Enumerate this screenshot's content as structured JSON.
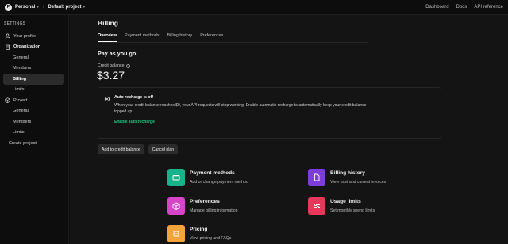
{
  "topbar": {
    "org_initial": "P",
    "org": "Personal",
    "slash": "/",
    "project": "Default project",
    "links": [
      "Dashboard",
      "Docs",
      "API reference"
    ]
  },
  "sidebar": {
    "heading": "SETTINGS",
    "your_profile": "Your profile",
    "organization": "Organization",
    "org_items": [
      "General",
      "Members",
      "Billing",
      "Limits"
    ],
    "project": "Project",
    "project_items": [
      "General",
      "Members",
      "Limits"
    ],
    "create_project": "+ Create project"
  },
  "billing": {
    "title": "Billing",
    "tabs": [
      "Overview",
      "Payment methods",
      "Billing history",
      "Preferences"
    ],
    "plan": "Pay as you go",
    "credit_label": "Credit balance",
    "credit_value": "$3.27",
    "notice_title": "Auto recharge is off",
    "notice_text": "When your credit balance reaches $0, your API requests will stop working. Enable automatic recharge to automatically keep your credit balance topped up.",
    "notice_link": "Enable auto recharge",
    "add_credit": "Add to credit balance",
    "cancel_plan": "Cancel plan"
  },
  "cards": [
    {
      "title": "Payment methods",
      "desc": "Add or change payment method",
      "icon": "card-icon",
      "color": "#17b38a"
    },
    {
      "title": "Billing history",
      "desc": "View past and current invoices",
      "icon": "document-icon",
      "color": "#7c3ddb"
    },
    {
      "title": "Preferences",
      "desc": "Manage billing information",
      "icon": "box-icon",
      "color": "#d645c8"
    },
    {
      "title": "Usage limits",
      "desc": "Set monthly spend limits",
      "icon": "sliders-icon",
      "color": "#e5385a"
    },
    {
      "title": "Pricing",
      "desc": "View pricing and FAQs",
      "icon": "tag-icon",
      "color": "#f2a43a"
    }
  ]
}
